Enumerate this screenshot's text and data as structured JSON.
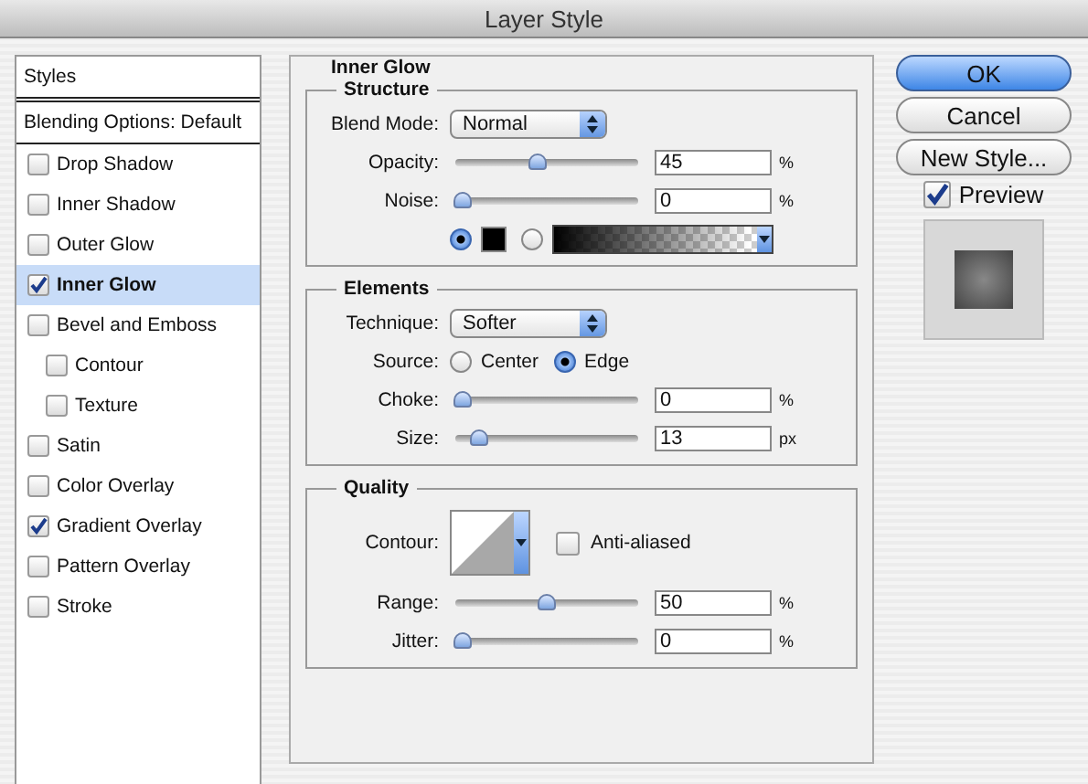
{
  "window": {
    "title": "Layer Style"
  },
  "sidebar": {
    "header": "Styles",
    "items": [
      {
        "kind": "heading",
        "label": "Blending Options: Default"
      },
      {
        "kind": "check",
        "label": "Drop Shadow",
        "checked": false,
        "selected": false
      },
      {
        "kind": "check",
        "label": "Inner Shadow",
        "checked": false,
        "selected": false
      },
      {
        "kind": "check",
        "label": "Outer Glow",
        "checked": false,
        "selected": false
      },
      {
        "kind": "check",
        "label": "Inner Glow",
        "checked": true,
        "selected": true
      },
      {
        "kind": "check",
        "label": "Bevel and Emboss",
        "checked": false,
        "selected": false,
        "children": [
          {
            "kind": "check",
            "label": "Contour",
            "checked": false,
            "selected": false
          },
          {
            "kind": "check",
            "label": "Texture",
            "checked": false,
            "selected": false
          }
        ]
      },
      {
        "kind": "check",
        "label": "Satin",
        "checked": false,
        "selected": false
      },
      {
        "kind": "check",
        "label": "Color Overlay",
        "checked": false,
        "selected": false
      },
      {
        "kind": "check",
        "label": "Gradient Overlay",
        "checked": true,
        "selected": false
      },
      {
        "kind": "check",
        "label": "Pattern Overlay",
        "checked": false,
        "selected": false
      },
      {
        "kind": "check",
        "label": "Stroke",
        "checked": false,
        "selected": false
      }
    ]
  },
  "panel": {
    "title": "Inner Glow",
    "sections": [
      {
        "title": "Structure",
        "rows": [
          {
            "kind": "select",
            "label": "Blend Mode:",
            "value": "Normal"
          },
          {
            "kind": "slider",
            "label": "Opacity:",
            "level": 0.45,
            "value": "45",
            "unit": "%"
          },
          {
            "kind": "slider",
            "label": "Noise:",
            "level": 0,
            "value": "0",
            "unit": "%"
          },
          {
            "kind": "fill",
            "options": [
              {
                "kind": "color",
                "selected": true
              },
              {
                "kind": "gradient",
                "selected": false
              }
            ]
          }
        ]
      },
      {
        "title": "Elements",
        "rows": [
          {
            "kind": "select",
            "label": "Technique:",
            "value": "Softer"
          },
          {
            "kind": "radio",
            "label": "Source:",
            "options": [
              {
                "label": "Center",
                "selected": false
              },
              {
                "label": "Edge",
                "selected": true
              }
            ]
          },
          {
            "kind": "slider",
            "label": "Choke:",
            "level": 0,
            "value": "0",
            "unit": "%"
          },
          {
            "kind": "slider",
            "label": "Size:",
            "level": 0.1,
            "value": "13",
            "unit": "px"
          }
        ]
      },
      {
        "title": "Quality",
        "rows": [
          {
            "kind": "contour",
            "label": "Contour:",
            "option": {
              "label": "Anti-aliased",
              "checked": false
            }
          },
          {
            "kind": "slider",
            "label": "Range:",
            "level": 0.5,
            "value": "50",
            "unit": "%"
          },
          {
            "kind": "slider",
            "label": "Jitter:",
            "level": 0,
            "value": "0",
            "unit": "%"
          }
        ]
      }
    ]
  },
  "buttons": [
    {
      "label": "OK",
      "default": true
    },
    {
      "label": "Cancel",
      "default": false
    },
    {
      "label": "New Style...",
      "default": false
    }
  ],
  "preview": {
    "label": "Preview",
    "checked": true
  }
}
